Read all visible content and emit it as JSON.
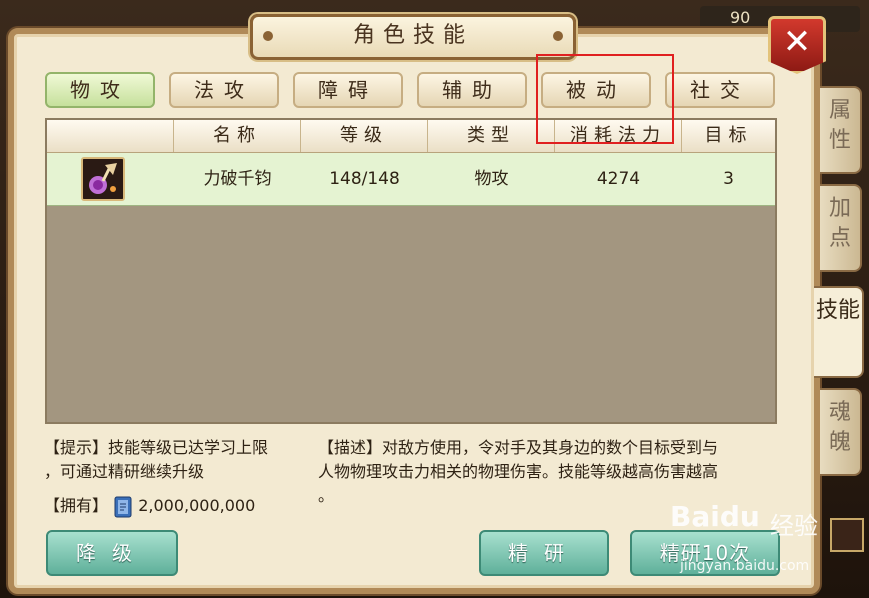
{
  "window": {
    "title": "角色技能",
    "level": "90"
  },
  "tabs": [
    {
      "label": "物攻",
      "active": true
    },
    {
      "label": "法攻",
      "active": false
    },
    {
      "label": "障碍",
      "active": false
    },
    {
      "label": "辅助",
      "active": false
    },
    {
      "label": "被动",
      "active": false
    },
    {
      "label": "社交",
      "active": false
    }
  ],
  "table": {
    "headers": [
      "",
      "名称",
      "等级",
      "类型",
      "消耗法力",
      "目标"
    ],
    "rows": [
      {
        "icon": "skill-icon",
        "name": "力破千钧",
        "level": "148/148",
        "type": "物攻",
        "mana": "4274",
        "target": "3"
      }
    ]
  },
  "hint": {
    "line1": "【提示】技能等级已达学习上限",
    "line2": "，可通过精研继续升级"
  },
  "owned": {
    "label": "【拥有】",
    "value": "2,000,000,000",
    "icon": "book-icon"
  },
  "description": {
    "line1": "【描述】对敌方使用，令对手及其身边的数个目标受到与",
    "line2": "人物物理攻击力相关的物理伤害。技能等级越高伤害越高",
    "line3": "。"
  },
  "buttons": {
    "downgrade": "降级",
    "refine": "精研",
    "refine10": "精研10次"
  },
  "side_tabs": [
    {
      "label": "属性",
      "active": false
    },
    {
      "label": "加点",
      "active": false
    },
    {
      "label": "技能",
      "active": true
    },
    {
      "label": "魂魄",
      "active": false
    }
  ],
  "watermark": {
    "logo": "Baidu",
    "text": "经验",
    "url": "jingyan.baidu.com"
  },
  "colors": {
    "highlight": "#e02020",
    "active_tab": "#c6e09c",
    "button": "#5fb09a"
  }
}
